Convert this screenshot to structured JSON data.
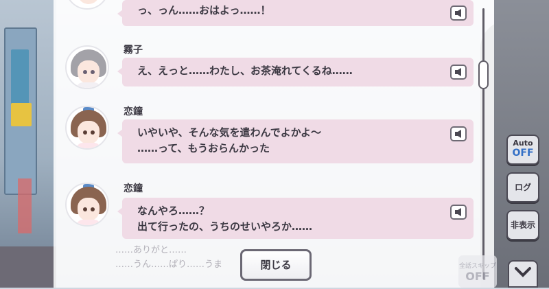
{
  "log": {
    "entries": [
      {
        "speaker": "",
        "lines": [
          "っ、っん……おはよっ……！"
        ]
      },
      {
        "speaker": "霧子",
        "lines": [
          "え、えっと……わたし、お茶淹れてくるね……"
        ]
      },
      {
        "speaker": "恋鐘",
        "lines": [
          "いやいや、そんな気を遣わんでよかよ～",
          "……って、もうおらんかった"
        ]
      },
      {
        "speaker": "恋鐘",
        "lines": [
          "なんやろ……？",
          "出て行ったの、うちのせいやろか……"
        ]
      }
    ],
    "voice_icon": "speaker-icon",
    "close_label": "閉じる",
    "background_lines": [
      "……ありがと……",
      "……うん……ぱり……うま"
    ]
  },
  "controls": {
    "auto_label": "Auto",
    "auto_state": "OFF",
    "log_label": "ログ",
    "hide_label": "非表示",
    "scroll_down_icon": "chevron-down-icon"
  },
  "background_hud": {
    "label_small": "全話スキップ",
    "label_big": "OFF"
  },
  "colors": {
    "bubble": "#f0dbe6",
    "auto_off": "#3470c6",
    "border": "#4c4a55"
  }
}
